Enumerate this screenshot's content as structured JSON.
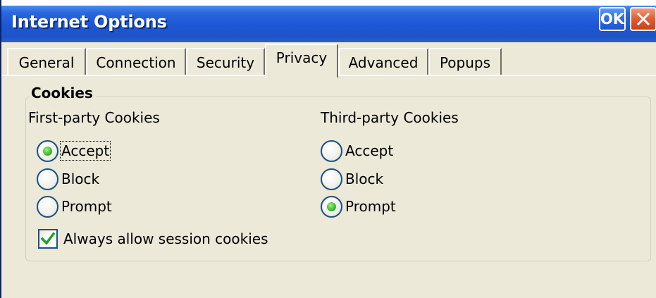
{
  "window": {
    "title": "Internet Options",
    "ok_label": "OK"
  },
  "tabs": [
    {
      "label": "General"
    },
    {
      "label": "Connection"
    },
    {
      "label": "Security"
    },
    {
      "label": "Privacy"
    },
    {
      "label": "Advanced"
    },
    {
      "label": "Popups"
    }
  ],
  "active_tab": "Privacy",
  "cookies": {
    "group_title": "Cookies",
    "first_party": {
      "heading": "First-party Cookies",
      "options": [
        {
          "label": "Accept",
          "selected": true
        },
        {
          "label": "Block",
          "selected": false
        },
        {
          "label": "Prompt",
          "selected": false
        }
      ]
    },
    "third_party": {
      "heading": "Third-party Cookies",
      "options": [
        {
          "label": "Accept",
          "selected": false
        },
        {
          "label": "Block",
          "selected": false
        },
        {
          "label": "Prompt",
          "selected": true
        }
      ]
    },
    "session_cookies": {
      "label": "Always allow session cookies",
      "checked": true
    }
  },
  "colors": {
    "titlebar": "#1d56d3",
    "dialog_bg": "#ece9d8",
    "radio_selected": "#3fbf2a",
    "check_mark": "#21a121"
  }
}
